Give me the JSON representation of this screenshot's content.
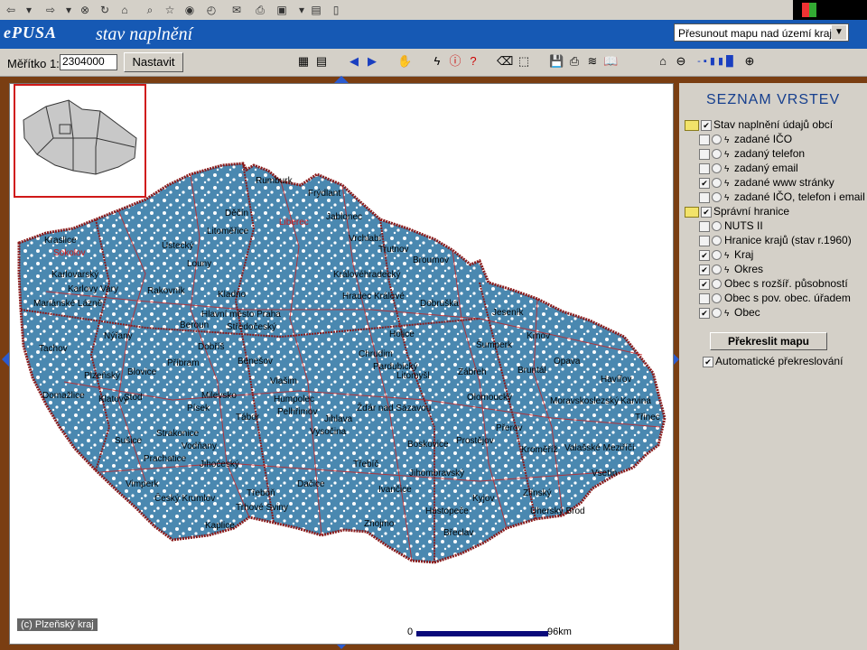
{
  "app": {
    "logo": "ePUSA",
    "title": "stav naplnění"
  },
  "move_map_select": {
    "value": "Přesunout mapu nad území kraje..."
  },
  "scale": {
    "label": "Měřítko 1:",
    "value": "2304000",
    "set_button": "Nastavit"
  },
  "layers_panel": {
    "title": "SEZNAM VRSTEV",
    "groups": [
      {
        "label": "Stav naplnění údajů obcí",
        "checked": true,
        "items": [
          {
            "label": "zadané IČO",
            "checked": false
          },
          {
            "label": "zadaný telefon",
            "checked": false
          },
          {
            "label": "zadaný email",
            "checked": false
          },
          {
            "label": "zadané www stránky",
            "checked": true
          },
          {
            "label": "zadané IČO, telefon i email",
            "checked": false
          }
        ]
      },
      {
        "label": "Správní hranice",
        "checked": true,
        "items": [
          {
            "label": "NUTS II",
            "checked": false
          },
          {
            "label": "Hranice krajů (stav r.1960)",
            "checked": false
          },
          {
            "label": "Kraj",
            "checked": true
          },
          {
            "label": "Okres",
            "checked": true
          },
          {
            "label": "Obec s rozšíř. působností",
            "checked": true
          },
          {
            "label": "Obec s pov. obec. úřadem",
            "checked": false
          },
          {
            "label": "Obec",
            "checked": true
          }
        ]
      }
    ],
    "redraw_button": "Překreslit mapu",
    "auto_redraw_label": "Automatické překreslování",
    "auto_redraw_checked": true
  },
  "map": {
    "scalebar_start": "0",
    "scalebar_end": "96km",
    "copyright": "(c) Plzeňský kraj",
    "fill_color": "#4a88b0",
    "border_color": "#8b1a1a",
    "labels_black": [
      "Rumburk",
      "Frýdlant",
      "Děčín",
      "Liberec",
      "Jablonec",
      "Vrchlabí",
      "Trutnov",
      "Broumov",
      "Kraslice",
      "Sokolov",
      "Karlovarský",
      "Karlovy Vary",
      "Mariánské Lázně",
      "Litoměřice",
      "Ústecký",
      "Louny",
      "Rakovník",
      "Kladno",
      "Hlavní město Praha",
      "Středočeský",
      "Královéhradecký",
      "Hradec Králové",
      "Dobruška",
      "Jeseník",
      "Krnov",
      "Beroun",
      "Příbram",
      "Tachov",
      "Nýřany",
      "Plzeňský",
      "Stod",
      "Domažlice",
      "Klatovy",
      "Benešov",
      "Vlašim",
      "Pardubický",
      "Litomyšl",
      "Zábřeh",
      "Šumperk",
      "Bruntál",
      "Opava",
      "Havířov",
      "Olomoucký",
      "Moravskoslezský",
      "Karviná",
      "Třinec",
      "Písek",
      "Tábor",
      "Jihlava",
      "Vysočina",
      "Žďár nad Sázavou",
      "Strakonice",
      "Vodňany",
      "Prachatice",
      "Jihočeský",
      "Vimperk",
      "Český Krumlov",
      "Kaplice",
      "Trhové Sviny",
      "Třeboň",
      "Dačice",
      "Třebíč",
      "Boskovice",
      "Jihomoravský",
      "Zlínský",
      "Vsetín",
      "Kroměříž",
      "Prostějov",
      "Přerov",
      "Ivančice",
      "Znojmo",
      "Hustopeče",
      "Břeclav",
      "Kyjov",
      "Uherský Brod",
      "Valašské Meziříčí",
      "Pelhřimov",
      "Humpolec",
      "Chrudim",
      "Holice",
      "Blovice",
      "Sušice",
      "Milevsko",
      "Dobříš"
    ]
  }
}
